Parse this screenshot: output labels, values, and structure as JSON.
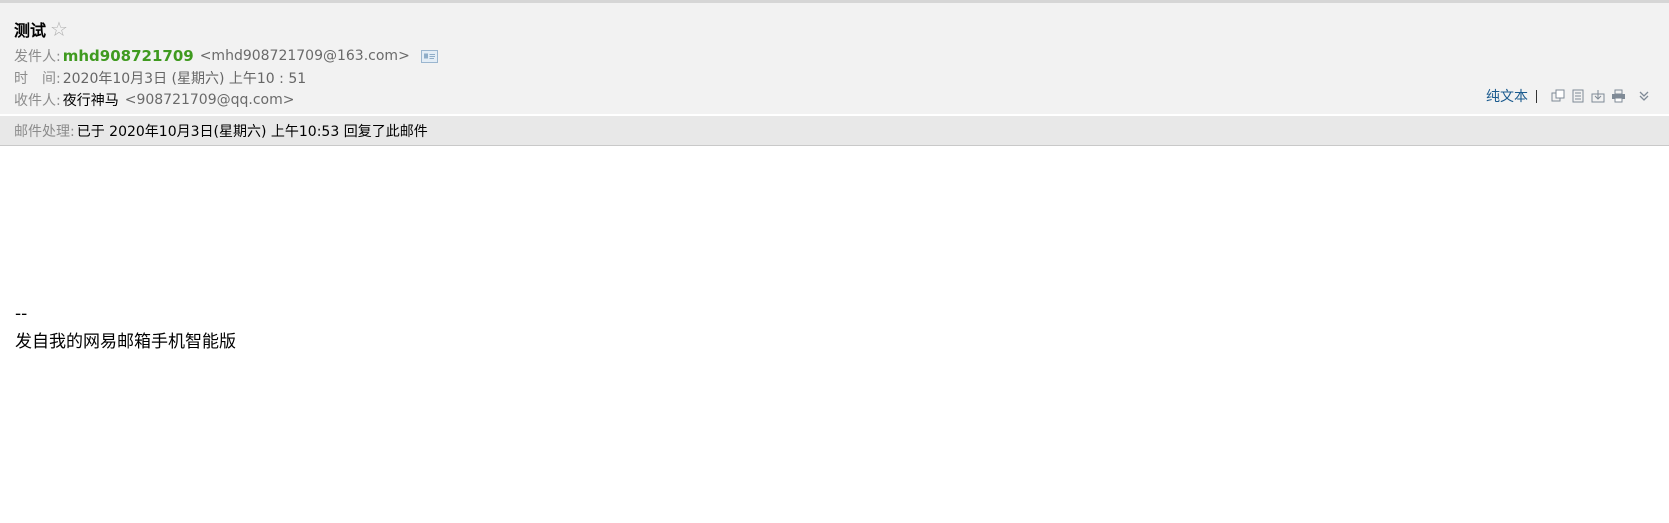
{
  "email": {
    "subject": "测试",
    "star_icon": "star-outline-icon",
    "from": {
      "label": "发件人:",
      "name": "mhd908721709",
      "address": "<mhd908721709@163.com>",
      "contact_icon": "contact-card-icon"
    },
    "time": {
      "label": "时　间:",
      "value": "2020年10月3日 (星期六) 上午10 : 51"
    },
    "to": {
      "label": "收件人:",
      "name": "夜行神马",
      "address": "<908721709@qq.com>"
    },
    "status": {
      "label": "邮件处理:",
      "text": "已于 2020年10月3日(星期六) 上午10:53 回复了此邮件"
    },
    "toolbar": {
      "plain_text": "纯文本",
      "icons": [
        "new-window-icon",
        "document-icon",
        "download-icon",
        "print-icon",
        "expand-down-icon"
      ]
    },
    "body": {
      "signature_sep": "--",
      "signature": "发自我的网易邮箱手机智能版"
    }
  },
  "colors": {
    "sender": "#3f9a1f",
    "link": "#1a5a8e",
    "header_bg": "#f2f2f2",
    "status_bg": "#e8e8e8"
  }
}
